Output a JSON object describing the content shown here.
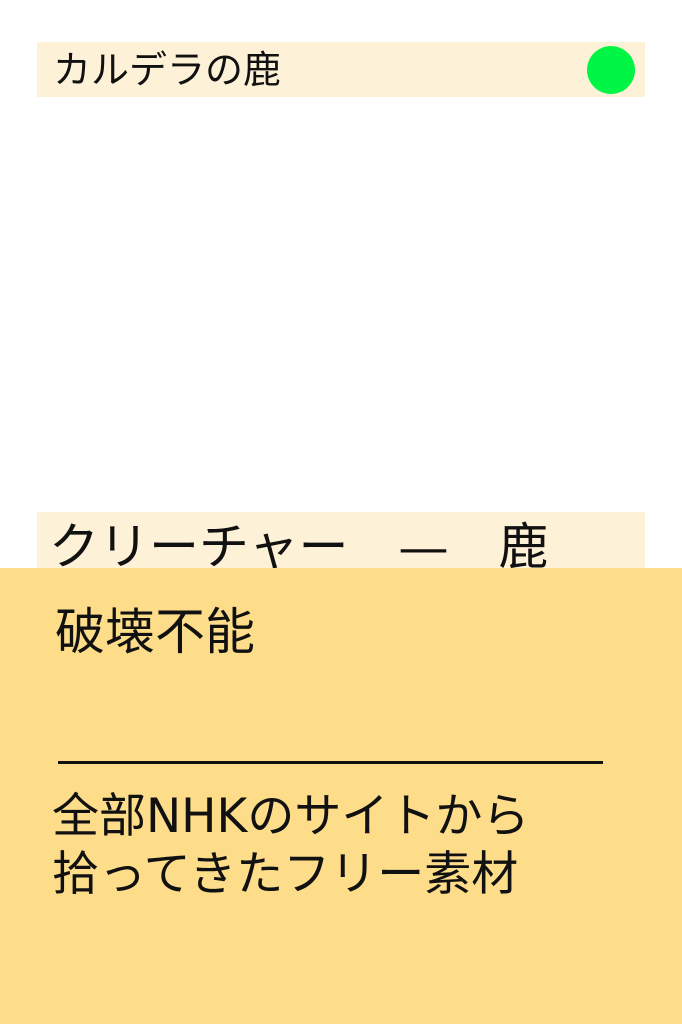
{
  "card": {
    "name": "カルデラの鹿",
    "mana_indicator_color": "#00f545",
    "type_line": "クリーチャー　—　鹿",
    "ability": "破壊不能",
    "flavor_lines": [
      "全部NHKのサイトから",
      "拾ってきたフリー素材"
    ]
  },
  "colors": {
    "name_bar": "#fdf2d7",
    "text_box": "#fddc8a"
  }
}
